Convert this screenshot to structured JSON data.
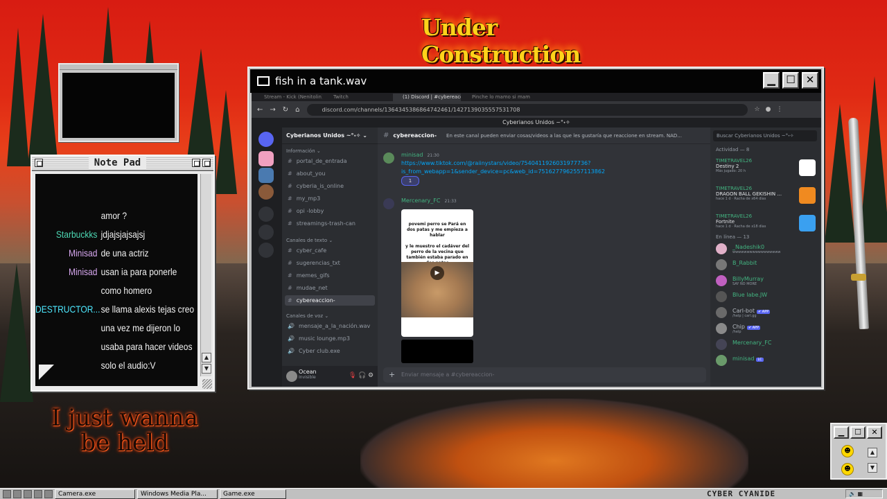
{
  "desktop": {
    "art_title": "Under Construction",
    "art_caption": "I just wanna be held"
  },
  "notepad": {
    "title": "Note Pad",
    "lines": [
      {
        "name": "",
        "name_color": "#f2f2f2",
        "text": "amor ?"
      },
      {
        "name": "Starbuckks",
        "name_color": "#4dd8b4",
        "text": "jdjajsjajsajsj"
      },
      {
        "name": "Minisad",
        "name_color": "#d8a8f0",
        "text": "de una actriz"
      },
      {
        "name": "Minisad",
        "name_color": "#d8a8f0",
        "text": "usan ia para ponerle"
      },
      {
        "name": "",
        "name_color": "#f2f2f2",
        "text": "como homero"
      },
      {
        "name": "DESTRUCTOR...",
        "name_color": "#4de8ff",
        "text": "se llama alexis tejas creo"
      },
      {
        "name": "",
        "name_color": "#f2f2f2",
        "text": "una vez me dijeron lo"
      },
      {
        "name": "",
        "name_color": "#f2f2f2",
        "text": "usaba para hacer videos"
      },
      {
        "name": "",
        "name_color": "#f2f2f2",
        "text": "solo el audio:V"
      }
    ]
  },
  "window": {
    "title": "fish in a tank.wav",
    "btn_min": "▁",
    "btn_max": "☐",
    "btn_close": "✕"
  },
  "browser": {
    "tabs": [
      "Stream - Kick (Nenitolin)",
      "Twitch",
      "(1) Discord | #cybereacc...",
      "Pinche lo mamo si mamas..."
    ],
    "url": "discord.com/channels/1364345386864742461/1427139035557531708",
    "nav_icons": [
      "←",
      "→",
      "↻",
      "⌂"
    ]
  },
  "discord": {
    "server_bar_title": "Cyberianos Unidos ~°˖✧",
    "guild_name": "Cyberianos Unidos ~°˖✧ ⌄",
    "categories": {
      "info": "Información ⌄",
      "text": "Canales de texto ⌄",
      "voice": "Canales de voz ⌄"
    },
    "info_channels": [
      "portal_de_entrada",
      "about_you",
      "cyberia_is_online",
      "my_mp3",
      "opi -lobby",
      "streamings-trash-can"
    ],
    "text_channels": [
      "cyber_cafe",
      "sugerencias_txt",
      "memes_gifs",
      "mudae_net",
      "cybereaccion-"
    ],
    "voice_channels": [
      "mensaje_a_la_nación.wav",
      "music lounge.mp3",
      "Cyber club.exe"
    ],
    "user": {
      "name": "Ocean",
      "status": "Invisible"
    },
    "channel_header": {
      "name": "cybereaccion-",
      "topic": "En este canal pueden enviar cosas/videos a las que les gustaría que reaccione en stream. NAD..."
    },
    "messages": [
      {
        "author": "minisad",
        "author_color": "#43b581",
        "time": "21:30",
        "text": "https://www.tiktok.com/@raiinystars/video/7540411926031977736?is_from_webapp=1&sender_device=pc&web_id=7516277962557113862",
        "reaction_count": "1"
      },
      {
        "author": "Mercenary_FC",
        "author_color": "#43b581",
        "time": "21:33",
        "video_caption_1": "povemi perro se Pará en dos patas y me empieza a hablar",
        "video_caption_2": "y le muestro el cadáver del perro de la vecina que también estaba parado en dos patas"
      }
    ],
    "composer_placeholder": "Enviar mensaje a #cybereaccion-",
    "members": {
      "search_placeholder": "Buscar Cyberianos Unidos ~°˖✧",
      "activity_header": "Actividad — 8",
      "activities": [
        {
          "user": "TIMETRAVEL26",
          "game": "Destiny 2",
          "detail": "Más jugado: 20 h",
          "thumb_color": "#ffffff"
        },
        {
          "user": "TIMETRAVEL26",
          "game": "DRAGON BALL GEKISHIN ...",
          "detail": "hace 1 d · Racha de x64 días",
          "thumb_color": "#f08a20"
        },
        {
          "user": "TIMETRAVEL26",
          "game": "Fortnite",
          "detail": "hace 1 d · Racha de x18 días",
          "thumb_color": "#3aa0f0"
        }
      ],
      "online_header": "En línea — 13",
      "list": [
        {
          "name": "_Nadeshik0",
          "color": "#43b581",
          "status": "wwwwwwwwwwwwwwwww",
          "badge": "",
          "av": "#e0b0c8"
        },
        {
          "name": "B_Rabbit",
          "color": "#43b581",
          "status": "",
          "badge": "",
          "av": "#777"
        },
        {
          "name": "BillyMurray",
          "color": "#43b581",
          "status": "SAY NO MORE",
          "badge": "",
          "av": "#c060c0"
        },
        {
          "name": "Blue labe.JW",
          "color": "#43b581",
          "status": "",
          "badge": "",
          "av": "#555"
        },
        {
          "name": "Carl-bot",
          "color": "#b5bac1",
          "status": "/help | carl.gg",
          "badge": "✔ APP",
          "av": "#6a6a6a"
        },
        {
          "name": "Chip",
          "color": "#b5bac1",
          "status": "/help",
          "badge": "✔ APP",
          "av": "#8a8a8a"
        },
        {
          "name": "Mercenary_FC",
          "color": "#43b581",
          "status": "",
          "badge": "",
          "av": "#445"
        },
        {
          "name": "minisad",
          "color": "#43b581",
          "status": "",
          "badge": "LC",
          "av": "#6a9a6a"
        }
      ]
    }
  },
  "taskbar": {
    "buttons": [
      "Camera.exe",
      "Windows Media Pla...",
      "Game.exe"
    ],
    "brand": "CYBER CYANIDE"
  }
}
